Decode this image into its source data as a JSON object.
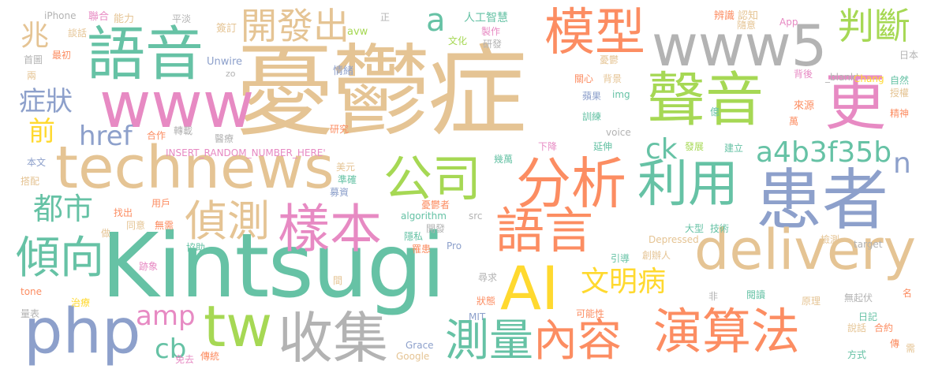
{
  "colors": {
    "tan": "#e5c494",
    "teal": "#66c2a5",
    "gray": "#b3b3b3",
    "lime": "#a6d854",
    "pink": "#e78ac3",
    "blue": "#8da0cb",
    "orange": "#fc8d62",
    "yellow": "#ffd92f"
  },
  "words": [
    {
      "text": "憂鬱症",
      "color": "tan"
    },
    {
      "text": "Kintsugi",
      "color": "teal"
    },
    {
      "text": "www",
      "color": "pink"
    },
    {
      "text": "www5",
      "color": "gray"
    },
    {
      "text": "語音",
      "color": "teal"
    },
    {
      "text": "technews",
      "color": "tan"
    },
    {
      "text": "聲音",
      "color": "lime"
    },
    {
      "text": "患者",
      "color": "blue"
    },
    {
      "text": "模型",
      "color": "orange"
    },
    {
      "text": "更",
      "color": "pink"
    },
    {
      "text": "分析",
      "color": "orange"
    },
    {
      "text": "公司",
      "color": "lime"
    },
    {
      "text": "利用",
      "color": "teal"
    },
    {
      "text": "樣本",
      "color": "pink"
    },
    {
      "text": "語言",
      "color": "orange"
    },
    {
      "text": "AI",
      "color": "yellow"
    },
    {
      "text": "php",
      "color": "blue"
    },
    {
      "text": "tw",
      "color": "lime"
    },
    {
      "text": "收集",
      "color": "gray"
    },
    {
      "text": "delivery",
      "color": "tan"
    },
    {
      "text": "傾向",
      "color": "teal"
    },
    {
      "text": "偵測",
      "color": "tan"
    },
    {
      "text": "演算法",
      "color": "orange"
    },
    {
      "text": "測量",
      "color": "teal"
    },
    {
      "text": "內容",
      "color": "orange"
    },
    {
      "text": "開發出",
      "color": "tan"
    },
    {
      "text": "判斷",
      "color": "lime"
    },
    {
      "text": "a4b3f35b",
      "color": "teal"
    },
    {
      "text": "文明病",
      "color": "yellow"
    },
    {
      "text": "都市",
      "color": "teal"
    },
    {
      "text": "href",
      "color": "blue"
    },
    {
      "text": "ck",
      "color": "teal"
    },
    {
      "text": "amp",
      "color": "pink"
    },
    {
      "text": "cb",
      "color": "teal"
    },
    {
      "text": "a",
      "color": "teal"
    },
    {
      "text": "n",
      "color": "blue"
    },
    {
      "text": "兆",
      "color": "tan"
    },
    {
      "text": "症狀",
      "color": "blue"
    },
    {
      "text": "前",
      "color": "yellow"
    },
    {
      "text": "iPhone",
      "color": "gray"
    },
    {
      "text": "聯合",
      "color": "pink"
    },
    {
      "text": "能力",
      "color": "tan"
    },
    {
      "text": "平淡",
      "color": "gray"
    },
    {
      "text": "正",
      "color": "gray"
    },
    {
      "text": "人工智慧",
      "color": "teal"
    },
    {
      "text": "辨識",
      "color": "orange"
    },
    {
      "text": "認知",
      "color": "tan"
    },
    {
      "text": "App",
      "color": "pink"
    },
    {
      "text": "談話",
      "color": "tan"
    },
    {
      "text": "簽訂",
      "color": "tan"
    },
    {
      "text": "avw",
      "color": "lime"
    },
    {
      "text": "文化",
      "color": "lime"
    },
    {
      "text": "製作",
      "color": "pink"
    },
    {
      "text": "研發",
      "color": "gray"
    },
    {
      "text": "隨意",
      "color": "tan"
    },
    {
      "text": "首圖",
      "color": "gray"
    },
    {
      "text": "最初",
      "color": "orange"
    },
    {
      "text": "Unwire",
      "color": "blue"
    },
    {
      "text": "zo",
      "color": "gray"
    },
    {
      "text": "情緒",
      "color": "blue"
    },
    {
      "text": "Chang",
      "color": "yellow"
    },
    {
      "text": "日本",
      "color": "gray"
    },
    {
      "text": "兩",
      "color": "tan"
    },
    {
      "text": "憂鬱",
      "color": "tan"
    },
    {
      "text": "關心",
      "color": "orange"
    },
    {
      "text": "背景",
      "color": "tan"
    },
    {
      "text": "背後",
      "color": "pink"
    },
    {
      "text": "_blank'",
      "color": "gray"
    },
    {
      "text": "自然",
      "color": "teal"
    },
    {
      "text": "授權",
      "color": "tan"
    },
    {
      "text": "蘋果",
      "color": "blue"
    },
    {
      "text": "img",
      "color": "teal"
    },
    {
      "text": "來源",
      "color": "orange"
    },
    {
      "text": "億",
      "color": "teal"
    },
    {
      "text": "訓練",
      "color": "teal"
    },
    {
      "text": "萬",
      "color": "orange"
    },
    {
      "text": "精神",
      "color": "orange"
    },
    {
      "text": "研究",
      "color": "orange"
    },
    {
      "text": "voice",
      "color": "gray"
    },
    {
      "text": "合作",
      "color": "orange"
    },
    {
      "text": "轉載",
      "color": "gray"
    },
    {
      "text": "醫療",
      "color": "gray"
    },
    {
      "text": "INSERT_RANDOM_NUMBER_HERE'",
      "color": "pink"
    },
    {
      "text": "下降",
      "color": "pink"
    },
    {
      "text": "延伸",
      "color": "teal"
    },
    {
      "text": "發展",
      "color": "lime"
    },
    {
      "text": "建立",
      "color": "teal"
    },
    {
      "text": "本文",
      "color": "blue"
    },
    {
      "text": "美元",
      "color": "tan"
    },
    {
      "text": "幾萬",
      "color": "teal"
    },
    {
      "text": "搭配",
      "color": "tan"
    },
    {
      "text": "準確",
      "color": "teal"
    },
    {
      "text": "募資",
      "color": "blue"
    },
    {
      "text": "用戶",
      "color": "orange"
    },
    {
      "text": "找出",
      "color": "orange"
    },
    {
      "text": "憂鬱者",
      "color": "orange"
    },
    {
      "text": "algorithm",
      "color": "teal"
    },
    {
      "text": "src",
      "color": "gray"
    },
    {
      "text": "同意",
      "color": "tan"
    },
    {
      "text": "無需",
      "color": "orange"
    },
    {
      "text": "做",
      "color": "tan"
    },
    {
      "text": "開發",
      "color": "gray"
    },
    {
      "text": "大型",
      "color": "teal"
    },
    {
      "text": "技術",
      "color": "teal"
    },
    {
      "text": "隱私",
      "color": "teal"
    },
    {
      "text": "Depressed",
      "color": "tan"
    },
    {
      "text": "檢測",
      "color": "tan"
    },
    {
      "text": "target",
      "color": "gray"
    },
    {
      "text": "協助",
      "color": "teal"
    },
    {
      "text": "罹患",
      "color": "orange"
    },
    {
      "text": "Pro",
      "color": "blue"
    },
    {
      "text": "引導",
      "color": "teal"
    },
    {
      "text": "創辦人",
      "color": "tan"
    },
    {
      "text": "跡象",
      "color": "pink"
    },
    {
      "text": "間",
      "color": "tan"
    },
    {
      "text": "尋求",
      "color": "gray"
    },
    {
      "text": "tone",
      "color": "orange"
    },
    {
      "text": "治療",
      "color": "yellow"
    },
    {
      "text": "狀態",
      "color": "orange"
    },
    {
      "text": "非",
      "color": "gray"
    },
    {
      "text": "閱讀",
      "color": "teal"
    },
    {
      "text": "原理",
      "color": "tan"
    },
    {
      "text": "無起伏",
      "color": "gray"
    },
    {
      "text": "名",
      "color": "orange"
    },
    {
      "text": "量表",
      "color": "gray"
    },
    {
      "text": "MIT",
      "color": "blue"
    },
    {
      "text": "可能性",
      "color": "orange"
    },
    {
      "text": "日記",
      "color": "teal"
    },
    {
      "text": "說話",
      "color": "tan"
    },
    {
      "text": "合約",
      "color": "orange"
    },
    {
      "text": "傳",
      "color": "orange"
    },
    {
      "text": "Grace",
      "color": "blue"
    },
    {
      "text": "Google",
      "color": "tan"
    },
    {
      "text": "需",
      "color": "tan"
    },
    {
      "text": "免去",
      "color": "pink"
    },
    {
      "text": "傳統",
      "color": "orange"
    },
    {
      "text": "方式",
      "color": "teal"
    }
  ]
}
